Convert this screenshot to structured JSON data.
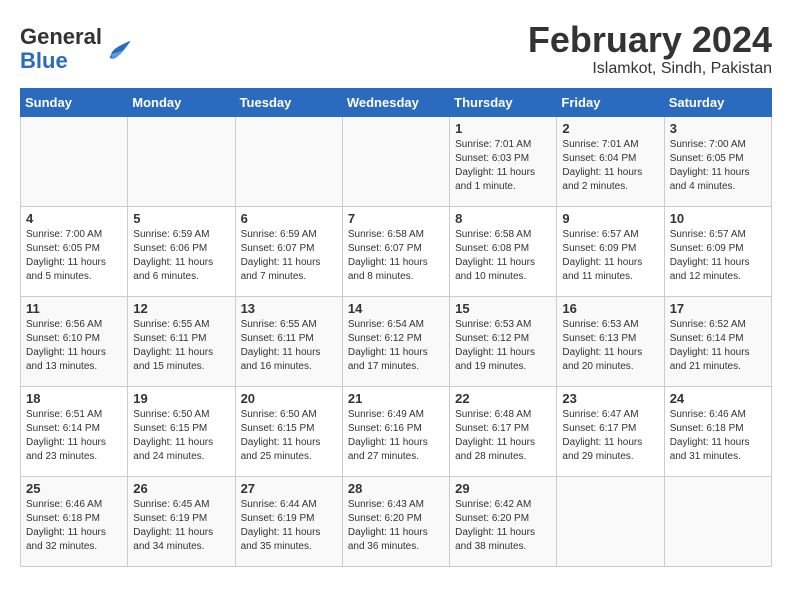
{
  "logo": {
    "general": "General",
    "blue": "Blue"
  },
  "title": "February 2024",
  "subtitle": "Islamkot, Sindh, Pakistan",
  "days_of_week": [
    "Sunday",
    "Monday",
    "Tuesday",
    "Wednesday",
    "Thursday",
    "Friday",
    "Saturday"
  ],
  "weeks": [
    [
      {
        "day": "",
        "info": ""
      },
      {
        "day": "",
        "info": ""
      },
      {
        "day": "",
        "info": ""
      },
      {
        "day": "",
        "info": ""
      },
      {
        "day": "1",
        "info": "Sunrise: 7:01 AM\nSunset: 6:03 PM\nDaylight: 11 hours and 1 minute."
      },
      {
        "day": "2",
        "info": "Sunrise: 7:01 AM\nSunset: 6:04 PM\nDaylight: 11 hours and 2 minutes."
      },
      {
        "day": "3",
        "info": "Sunrise: 7:00 AM\nSunset: 6:05 PM\nDaylight: 11 hours and 4 minutes."
      }
    ],
    [
      {
        "day": "4",
        "info": "Sunrise: 7:00 AM\nSunset: 6:05 PM\nDaylight: 11 hours and 5 minutes."
      },
      {
        "day": "5",
        "info": "Sunrise: 6:59 AM\nSunset: 6:06 PM\nDaylight: 11 hours and 6 minutes."
      },
      {
        "day": "6",
        "info": "Sunrise: 6:59 AM\nSunset: 6:07 PM\nDaylight: 11 hours and 7 minutes."
      },
      {
        "day": "7",
        "info": "Sunrise: 6:58 AM\nSunset: 6:07 PM\nDaylight: 11 hours and 8 minutes."
      },
      {
        "day": "8",
        "info": "Sunrise: 6:58 AM\nSunset: 6:08 PM\nDaylight: 11 hours and 10 minutes."
      },
      {
        "day": "9",
        "info": "Sunrise: 6:57 AM\nSunset: 6:09 PM\nDaylight: 11 hours and 11 minutes."
      },
      {
        "day": "10",
        "info": "Sunrise: 6:57 AM\nSunset: 6:09 PM\nDaylight: 11 hours and 12 minutes."
      }
    ],
    [
      {
        "day": "11",
        "info": "Sunrise: 6:56 AM\nSunset: 6:10 PM\nDaylight: 11 hours and 13 minutes."
      },
      {
        "day": "12",
        "info": "Sunrise: 6:55 AM\nSunset: 6:11 PM\nDaylight: 11 hours and 15 minutes."
      },
      {
        "day": "13",
        "info": "Sunrise: 6:55 AM\nSunset: 6:11 PM\nDaylight: 11 hours and 16 minutes."
      },
      {
        "day": "14",
        "info": "Sunrise: 6:54 AM\nSunset: 6:12 PM\nDaylight: 11 hours and 17 minutes."
      },
      {
        "day": "15",
        "info": "Sunrise: 6:53 AM\nSunset: 6:12 PM\nDaylight: 11 hours and 19 minutes."
      },
      {
        "day": "16",
        "info": "Sunrise: 6:53 AM\nSunset: 6:13 PM\nDaylight: 11 hours and 20 minutes."
      },
      {
        "day": "17",
        "info": "Sunrise: 6:52 AM\nSunset: 6:14 PM\nDaylight: 11 hours and 21 minutes."
      }
    ],
    [
      {
        "day": "18",
        "info": "Sunrise: 6:51 AM\nSunset: 6:14 PM\nDaylight: 11 hours and 23 minutes."
      },
      {
        "day": "19",
        "info": "Sunrise: 6:50 AM\nSunset: 6:15 PM\nDaylight: 11 hours and 24 minutes."
      },
      {
        "day": "20",
        "info": "Sunrise: 6:50 AM\nSunset: 6:15 PM\nDaylight: 11 hours and 25 minutes."
      },
      {
        "day": "21",
        "info": "Sunrise: 6:49 AM\nSunset: 6:16 PM\nDaylight: 11 hours and 27 minutes."
      },
      {
        "day": "22",
        "info": "Sunrise: 6:48 AM\nSunset: 6:17 PM\nDaylight: 11 hours and 28 minutes."
      },
      {
        "day": "23",
        "info": "Sunrise: 6:47 AM\nSunset: 6:17 PM\nDaylight: 11 hours and 29 minutes."
      },
      {
        "day": "24",
        "info": "Sunrise: 6:46 AM\nSunset: 6:18 PM\nDaylight: 11 hours and 31 minutes."
      }
    ],
    [
      {
        "day": "25",
        "info": "Sunrise: 6:46 AM\nSunset: 6:18 PM\nDaylight: 11 hours and 32 minutes."
      },
      {
        "day": "26",
        "info": "Sunrise: 6:45 AM\nSunset: 6:19 PM\nDaylight: 11 hours and 34 minutes."
      },
      {
        "day": "27",
        "info": "Sunrise: 6:44 AM\nSunset: 6:19 PM\nDaylight: 11 hours and 35 minutes."
      },
      {
        "day": "28",
        "info": "Sunrise: 6:43 AM\nSunset: 6:20 PM\nDaylight: 11 hours and 36 minutes."
      },
      {
        "day": "29",
        "info": "Sunrise: 6:42 AM\nSunset: 6:20 PM\nDaylight: 11 hours and 38 minutes."
      },
      {
        "day": "",
        "info": ""
      },
      {
        "day": "",
        "info": ""
      }
    ]
  ]
}
